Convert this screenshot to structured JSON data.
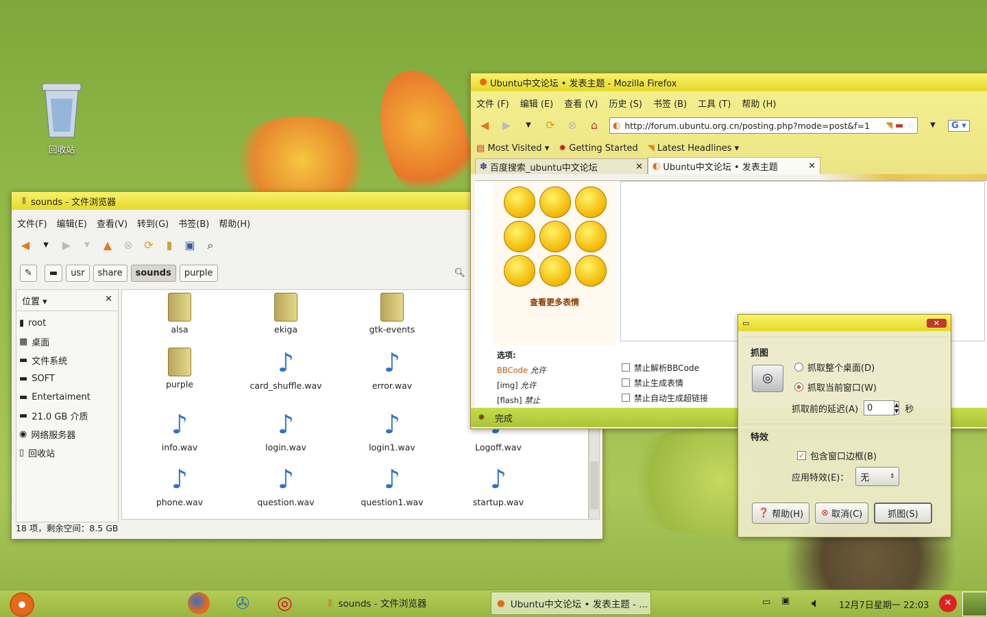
{
  "desktop": {
    "trash_label": "回收站"
  },
  "filebrowser": {
    "title": "sounds - 文件浏览器",
    "menu": [
      "文件(F)",
      "编辑(E)",
      "查看(V)",
      "转到(G)",
      "书签(B)",
      "帮助(H)"
    ],
    "breadcrumbs": [
      "usr",
      "share",
      "sounds",
      "purple"
    ],
    "zoom": "100",
    "sidebar_title": "位置",
    "sidebar": [
      "root",
      "桌面",
      "文件系统",
      "SOFT",
      "Entertaiment",
      "21.0 GB 介质",
      "网络服务器",
      "回收站"
    ],
    "files": [
      {
        "name": "alsa",
        "type": "folder"
      },
      {
        "name": "ekiga",
        "type": "folder"
      },
      {
        "name": "gtk-events",
        "type": "folder"
      },
      {
        "name": "purple",
        "type": "folder"
      },
      {
        "name": "card_shuffle.wav",
        "type": "sound"
      },
      {
        "name": "error.wav",
        "type": "sound"
      },
      {
        "name": "info.wav",
        "type": "sound"
      },
      {
        "name": "login.wav",
        "type": "sound"
      },
      {
        "name": "login1.wav",
        "type": "sound"
      },
      {
        "name": "Logoff.wav",
        "type": "sound"
      },
      {
        "name": "phone.wav",
        "type": "sound"
      },
      {
        "name": "question.wav",
        "type": "sound"
      },
      {
        "name": "question1.wav",
        "type": "sound"
      },
      {
        "name": "startup.wav",
        "type": "sound"
      }
    ],
    "status": "18 项，剩余空间：8.5 GB"
  },
  "firefox": {
    "title": "Ubuntu中文论坛 • 发表主题 - Mozilla Firefox",
    "menu": [
      "文件 (F)",
      "编辑 (E)",
      "查看 (V)",
      "历史 (S)",
      "书签 (B)",
      "工具 (T)",
      "帮助 (H)"
    ],
    "url": "http://forum.ubuntu.org.cn/posting.php?mode=post&f=1",
    "bookmarks": [
      "Most Visited",
      "Getting Started",
      "Latest Headlines"
    ],
    "tabs": [
      "百度搜索_ubuntu中文论坛",
      "Ubuntu中文论坛 • 发表主题"
    ],
    "more_smilies": "查看更多表情",
    "options_title": "选项:",
    "options": [
      {
        "k": "BBCode",
        "v": "允许"
      },
      {
        "k": "[img]",
        "v": "允许"
      },
      {
        "k": "[flash]",
        "v": "禁止"
      }
    ],
    "checkboxes": [
      "禁止解析BBCode",
      "禁止生成表情",
      "禁止自动生成超链接"
    ],
    "status": "完成"
  },
  "screenshot_dialog": {
    "section1": "抓图",
    "radio_desktop": "抓取整个桌面(D)",
    "radio_window": "抓取当前窗口(W)",
    "delay_label": "抓取前的延迟(A)",
    "delay_value": "0",
    "delay_unit": "秒",
    "section2": "特效",
    "border_check": "包含窗口边框(B)",
    "effect_label": "应用特效(E)：",
    "effect_value": "无",
    "help": "帮助(H)",
    "cancel": "取消(C)",
    "capture": "抓图(S)"
  },
  "taskbar": {
    "task1": "sounds - 文件浏览器",
    "task2": "Ubuntu中文论坛 • 发表主题 - ...",
    "clock": "12月7日星期一 22:03"
  }
}
